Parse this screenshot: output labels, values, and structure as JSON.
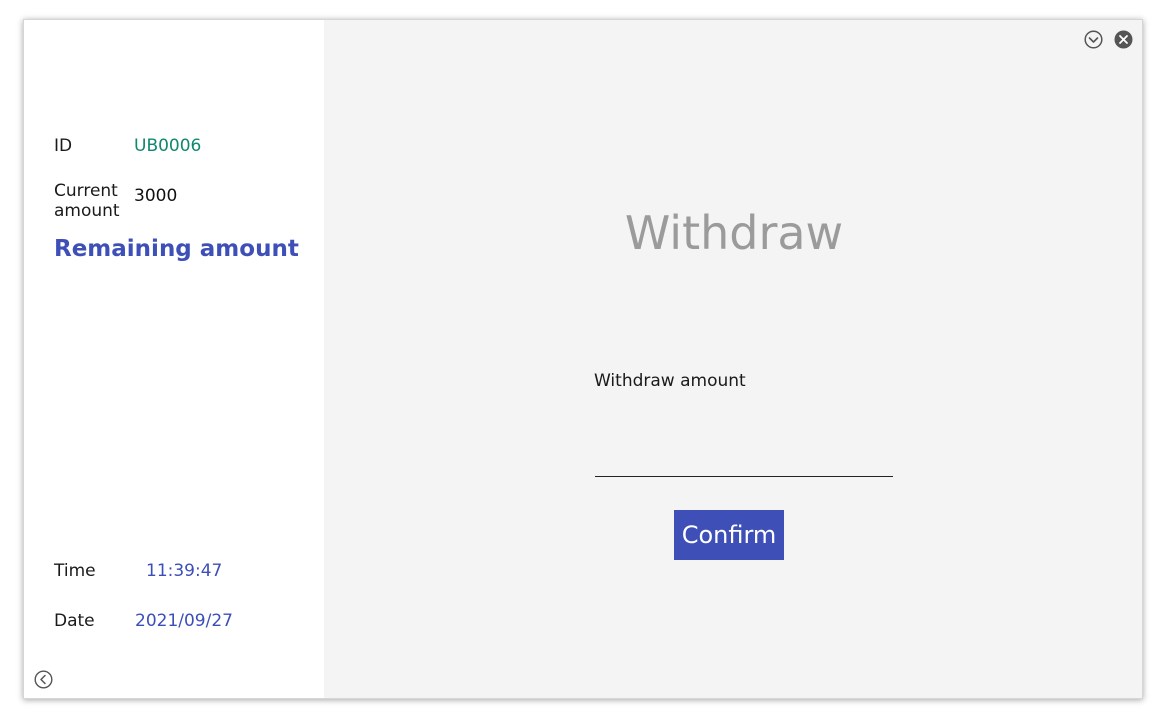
{
  "sidebar": {
    "id_label": "ID",
    "id_value": "UB0006",
    "current_label_line1": "Current",
    "current_label_line2": "amount",
    "current_value": "3000",
    "remaining_label": "Remaining amount",
    "time_label": "Time",
    "time_value": "11:39:47",
    "date_label": "Date",
    "date_value": "2021/09/27",
    "back_icon": "chevron-left-circle-icon"
  },
  "main": {
    "title": "Withdraw",
    "amount_label": "Withdraw amount",
    "amount_value": "",
    "confirm_label": "Confirm"
  },
  "window_controls": {
    "minimize_icon": "chevron-down-circle-icon",
    "close_icon": "close-circle-icon"
  },
  "colors": {
    "accent": "#3e4fb8",
    "id_value": "#10876f",
    "title": "#9b9b9b",
    "main_background": "#f4f4f4"
  }
}
